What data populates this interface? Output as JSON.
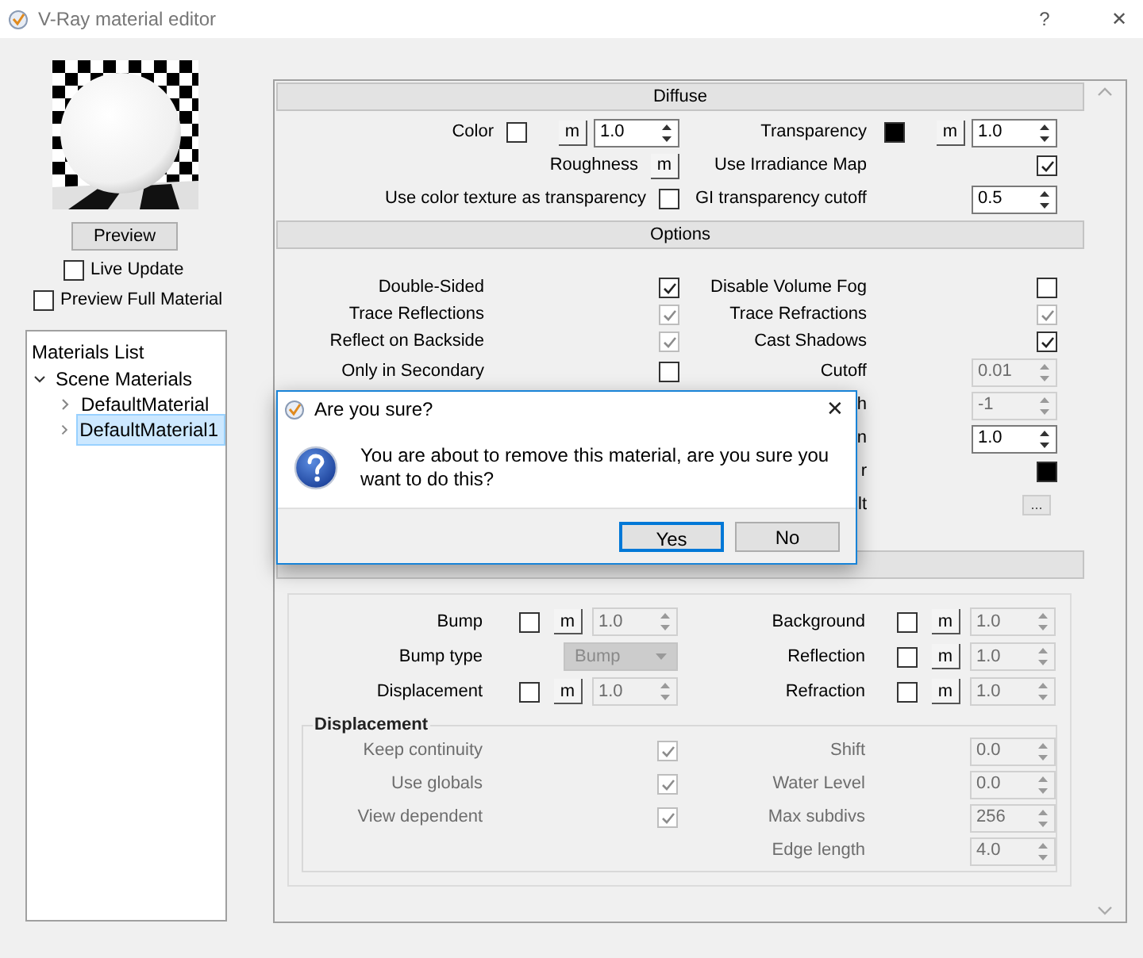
{
  "window": {
    "title": "V-Ray material editor",
    "help": "?",
    "close": "✕"
  },
  "preview": {
    "button": "Preview",
    "options": [
      {
        "label": "Live Update",
        "checked": false
      },
      {
        "label": "Preview Full Material",
        "checked": false
      }
    ]
  },
  "materials_list": {
    "title": "Materials List",
    "tree": [
      {
        "label": "Scene Materials",
        "expanded": true,
        "selected": false,
        "children": [
          {
            "label": "DefaultMaterial",
            "expanded": false,
            "selected": false
          },
          {
            "label": "DefaultMaterial1",
            "expanded": false,
            "selected": true
          }
        ]
      }
    ]
  },
  "sections": [
    {
      "title": "Diffuse",
      "rows": [
        {
          "left": {
            "kind": "color_map",
            "label": "Color",
            "color": "#ffffff",
            "map_button": "m",
            "value": "1.0"
          },
          "right": {
            "kind": "color_map",
            "label": "Transparency",
            "color": "#000000",
            "map_button": "m",
            "value": "1.0"
          }
        },
        {
          "left": {
            "kind": "map_button",
            "label": "Roughness",
            "map_button": "m"
          },
          "right": {
            "kind": "check",
            "label": "Use Irradiance Map",
            "checked": true,
            "disabled": false
          }
        },
        {
          "left": {
            "kind": "check",
            "label": "Use color texture as transparency",
            "checked": false,
            "disabled": false
          },
          "right": {
            "kind": "spin",
            "label": "GI transparency cutoff",
            "value": "0.5",
            "disabled": false
          }
        }
      ]
    },
    {
      "title": "Options",
      "rows": [
        {
          "left": {
            "kind": "check",
            "label": "Double-Sided",
            "checked": true,
            "disabled": false
          },
          "right": {
            "kind": "check",
            "label": "Disable Volume Fog",
            "checked": false,
            "disabled": false
          }
        },
        {
          "left": {
            "kind": "check",
            "label": "Trace Reflections",
            "checked": true,
            "disabled": true
          },
          "right": {
            "kind": "check",
            "label": "Trace Refractions",
            "checked": true,
            "disabled": true
          }
        },
        {
          "left": {
            "kind": "check",
            "label": "Reflect on Backside",
            "checked": true,
            "disabled": true
          },
          "right": {
            "kind": "check",
            "label": "Cast Shadows",
            "checked": true,
            "disabled": false
          }
        },
        {
          "left": {
            "kind": "check",
            "label": "Only in Secondary",
            "checked": false,
            "disabled": false
          },
          "right": {
            "kind": "spin",
            "label": "Cutoff",
            "value": "0.01",
            "disabled": true
          }
        },
        {
          "right": {
            "kind": "spin",
            "label": "h",
            "value": "-1",
            "disabled": true
          }
        },
        {
          "right": {
            "kind": "spin",
            "label": "n",
            "value": "1.0",
            "disabled": false
          }
        },
        {
          "right": {
            "kind": "color",
            "label": "r",
            "color": "#000000"
          }
        },
        {
          "right": {
            "kind": "more",
            "label": "lt",
            "button": "..."
          }
        }
      ]
    },
    {
      "rows": [
        {
          "left": {
            "kind": "check_map",
            "label": "Bump",
            "checked": false,
            "map_button": "m",
            "value": "1.0",
            "disabled": true
          },
          "right": {
            "kind": "check_map",
            "label": "Background",
            "checked": false,
            "map_button": "m",
            "value": "1.0",
            "disabled": true
          }
        },
        {
          "left": {
            "kind": "dropdown",
            "label": "Bump type",
            "value": "Bump",
            "disabled": true
          },
          "right": {
            "kind": "check_map",
            "label": "Reflection",
            "checked": false,
            "map_button": "m",
            "value": "1.0",
            "disabled": true
          }
        },
        {
          "left": {
            "kind": "check_map",
            "label": "Displacement",
            "checked": false,
            "map_button": "m",
            "value": "1.0",
            "disabled": true
          },
          "right": {
            "kind": "check_map",
            "label": "Refraction",
            "checked": false,
            "map_button": "m",
            "value": "1.0",
            "disabled": true
          }
        }
      ],
      "group": {
        "title": "Displacement",
        "disabled": true,
        "rows": [
          {
            "left": {
              "kind": "check",
              "label": "Keep continuity",
              "checked": true,
              "disabled": true
            },
            "right": {
              "kind": "spin",
              "label": "Shift",
              "value": "0.0",
              "disabled": true
            }
          },
          {
            "left": {
              "kind": "check",
              "label": "Use globals",
              "checked": true,
              "disabled": true
            },
            "right": {
              "kind": "spin",
              "label": "Water Level",
              "value": "0.0",
              "disabled": true
            }
          },
          {
            "left": {
              "kind": "check",
              "label": "View dependent",
              "checked": true,
              "disabled": true
            },
            "right": {
              "kind": "spin",
              "label": "Max subdivs",
              "value": "256",
              "disabled": true
            }
          },
          {
            "right": {
              "kind": "spin",
              "label": "Edge length",
              "value": "4.0",
              "disabled": true
            }
          }
        ]
      }
    }
  ],
  "dialog": {
    "title": "Are you sure?",
    "close": "✕",
    "message": "You are about to remove this material, are you sure you want to do this?",
    "buttons": [
      {
        "label": "Yes",
        "default": true
      },
      {
        "label": "No",
        "default": false
      }
    ]
  }
}
